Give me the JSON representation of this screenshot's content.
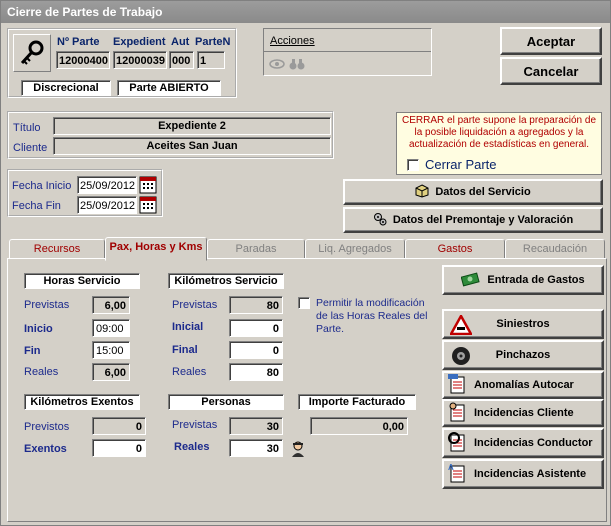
{
  "window": {
    "title": "Cierre de Partes de Trabajo"
  },
  "header": {
    "col_parte": "Nº Parte",
    "col_expedient": "Expedient",
    "col_aut": "Aut",
    "col_parten": "ParteN",
    "val_parte": "12000400",
    "val_expedient": "12000039",
    "val_aut": "000",
    "val_parten": "1",
    "discrecional": "Discrecional",
    "estado": "Parte ABIERTO"
  },
  "acciones": {
    "label": "Acciones"
  },
  "buttons": {
    "aceptar": "Aceptar",
    "cancelar": "Cancelar"
  },
  "info": {
    "titulo_label": "Título",
    "titulo_value": "Expediente 2",
    "cliente_label": "Cliente",
    "cliente_value": "Aceites San Juan"
  },
  "cerrar": {
    "note": "CERRAR el parte supone la preparación de la posible liquidación a agregados y la actualización de estadísticas en general.",
    "checkbox_label": "Cerrar Parte"
  },
  "fechas": {
    "inicio_label": "Fecha Inicio",
    "inicio_value": "25/09/2012",
    "fin_label": "Fecha Fin",
    "fin_value": "25/09/2012"
  },
  "side_buttons": {
    "datos_servicio": "Datos del Servicio",
    "datos_premontaje": "Datos del Premontaje y Valoración"
  },
  "tabs": [
    "Recursos",
    "Pax, Horas y Kms",
    "Paradas",
    "Liq. Agregados",
    "Gastos",
    "Recaudación"
  ],
  "horas": {
    "title": "Horas Servicio",
    "previstas_label": "Previstas",
    "previstas": "6,00",
    "inicio_label": "Inicio",
    "inicio": "09:00",
    "fin_label": "Fin",
    "fin": "15:00",
    "reales_label": "Reales",
    "reales": "6,00"
  },
  "km": {
    "title": "Kilómetros Servicio",
    "previstas_label": "Previstas",
    "previstas": "80",
    "inicial_label": "Inicial",
    "inicial": "0",
    "final_label": "Final",
    "final": "0",
    "reales_label": "Reales",
    "reales": "80"
  },
  "permitir": {
    "label": "Permitir la modificación de las Horas Reales del Parte."
  },
  "km_exentos": {
    "title": "Kilómetros Exentos",
    "previstos_label": "Previstos",
    "previstos": "0",
    "exentos_label": "Exentos",
    "exentos": "0"
  },
  "personas": {
    "title": "Personas",
    "previstas_label": "Previstas",
    "previstas": "30",
    "reales_label": "Reales",
    "reales": "30"
  },
  "importe": {
    "title": "Importe Facturado",
    "value": "0,00"
  },
  "right_buttons": {
    "entrada_gastos": "Entrada de Gastos",
    "siniestros": "Siniestros",
    "pinchazos": "Pinchazos",
    "anomalias": "Anomalías Autocar",
    "inc_cliente": "Incidencias Cliente",
    "inc_conductor": "Incidencias Conductor",
    "inc_asistente": "Incidencias Asistente"
  }
}
